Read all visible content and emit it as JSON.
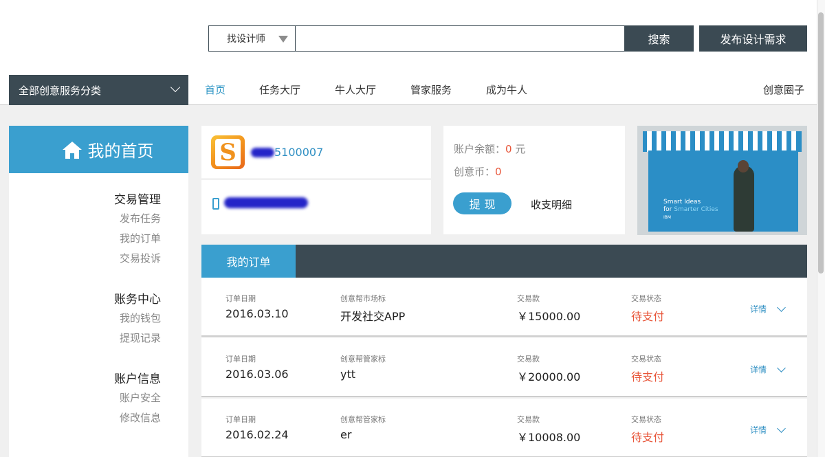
{
  "search": {
    "type_label": "找设计师",
    "query": "",
    "search_button": "搜索",
    "publish_button": "发布设计需求"
  },
  "nav": {
    "category_label": "全部创意服务分类",
    "items": [
      "首页",
      "任务大厅",
      "牛人大厅",
      "管家服务",
      "成为牛人"
    ],
    "active_index": 0,
    "right_link": "创意圈子"
  },
  "sidebar": {
    "title": "我的首页",
    "groups": [
      {
        "title": "交易管理",
        "links": [
          "发布任务",
          "我的订单",
          "交易投诉"
        ]
      },
      {
        "title": "账务中心",
        "links": [
          "我的钱包",
          "提现记录"
        ]
      },
      {
        "title": "账户信息",
        "links": [
          "账户安全",
          "修改信息"
        ]
      }
    ]
  },
  "profile": {
    "avatar_letter": "S",
    "username_suffix": "5100007"
  },
  "balance": {
    "balance_label": "账户余额：",
    "balance_value": "0",
    "balance_unit": " 元",
    "coin_label": "创意币：",
    "coin_value": "0",
    "withdraw_button": "提现",
    "details_link": "收支明细"
  },
  "banner": {
    "line1": "Smart Ideas",
    "line2a": "for ",
    "line2b": "Smarter Cities",
    "brand": "IBM"
  },
  "orders": {
    "tab_label": "我的订单",
    "detail_label": "详情",
    "colors": {
      "status": "#e8563a",
      "accent": "#3a9fcf",
      "dark": "#3b4a53"
    },
    "rows": [
      {
        "date_label": "订单日期",
        "date": "2016.03.10",
        "title_label": "创意帮市场标",
        "title": "开发社交APP",
        "amount_label": "交易款",
        "amount": "￥15000.00",
        "status_label": "交易状态",
        "status": "待支付"
      },
      {
        "date_label": "订单日期",
        "date": "2016.03.06",
        "title_label": "创意帮管家标",
        "title": "ytt",
        "amount_label": "交易款",
        "amount": "￥20000.00",
        "status_label": "交易状态",
        "status": "待支付"
      },
      {
        "date_label": "订单日期",
        "date": "2016.02.24",
        "title_label": "创意帮管家标",
        "title": "er",
        "amount_label": "交易款",
        "amount": "￥10008.00",
        "status_label": "交易状态",
        "status": "待支付"
      }
    ]
  }
}
